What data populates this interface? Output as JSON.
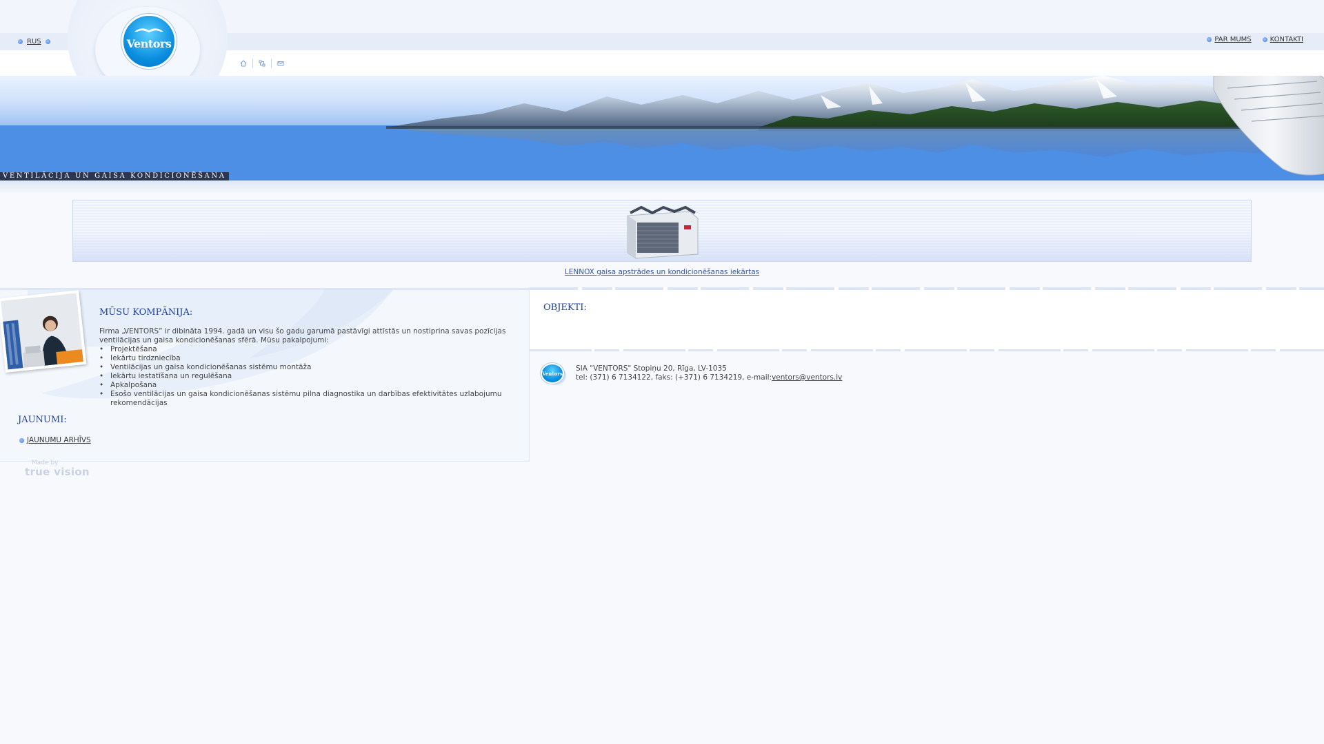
{
  "header": {
    "language_link": "RUS",
    "logo_text": "Ventors",
    "nav": [
      {
        "label": "PAR MUMS"
      },
      {
        "label": "KONTAKTI"
      }
    ],
    "utility_icons": [
      "home-icon",
      "sitemap-icon",
      "mail-icon"
    ]
  },
  "banner": {
    "tagline": "VENTILĀCIJA UN GAISA KONDICIONĒŠANA"
  },
  "feature": {
    "caption": "LENNOX gaisa apstrādes un kondicionēšanas iekārtas"
  },
  "company": {
    "title": "MŪSU KOMPĀNIJA:",
    "intro": "Firma „VENTORS” ir dibināta 1994. gadā un visu šo gadu garumā pastāvīgi attīstās un nostiprina savas pozīcijas ventilācijas un gaisa kondicionēšanas sfērā. Mūsu pakalpojumi:",
    "services": [
      "Projektēšana",
      "Iekārtu tirdzniecība",
      "Ventilācijas un gaisa kondicionēšanas sistēmu montāža",
      "Iekārtu iestatīšana un regulēšana",
      "Apkalpošana",
      "Esošo ventilācijas un gaisa kondicionēšanas sistēmu pilna diagnostika un darbības efektivitātes uzlabojumu rekomendācijas"
    ]
  },
  "news": {
    "title": "JAUNUMI:",
    "archive_link": "JAUNUMU ARHĪVS"
  },
  "credit": {
    "made_by": "Made by",
    "brand": "true vision"
  },
  "objects": {
    "title": "OBJEKTI:"
  },
  "footer": {
    "logo_text": "Ventors",
    "address": "SIA \"VENTORS\" Stopiņu 20, Rīga, LV-1035",
    "phone_prefix": "tel: (371) 6 7134122, faks: (+371) 6 7134219, e-mail:",
    "email": "ventors@ventors.lv"
  },
  "colors": {
    "heading_blue": "#1c3fa0",
    "link_blue": "#3a52a0",
    "accent_dot": "#3f78d8",
    "tagline_bg": "#2b3750"
  }
}
